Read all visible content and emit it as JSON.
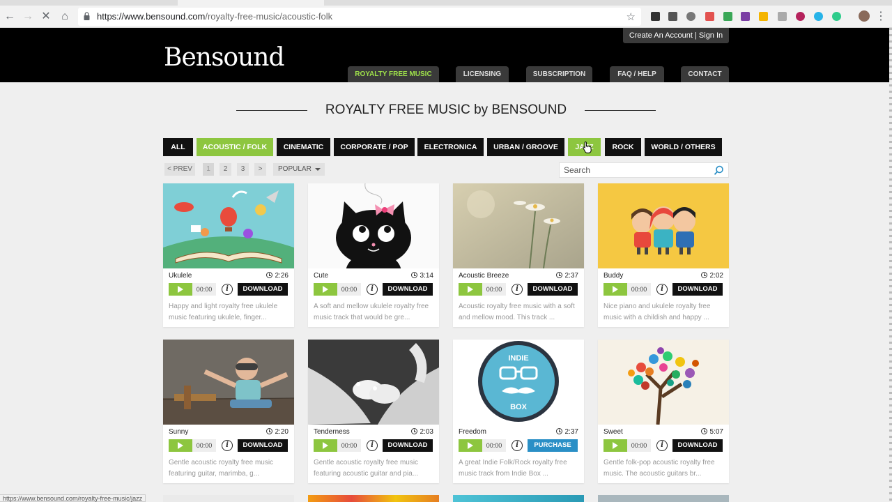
{
  "browser": {
    "url_host": "https://www.bensound.com",
    "url_path": "/royalty-free-music/acoustic-folk",
    "status_url": "https://www.bensound.com/royalty-free-music/jazz"
  },
  "header": {
    "logo": "Bensound",
    "account_link": "Create An Account | Sign In",
    "nav": [
      "ROYALTY FREE MUSIC",
      "LICENSING",
      "SUBSCRIPTION",
      "FAQ / HELP",
      "CONTACT"
    ],
    "accent": "#8dc63f"
  },
  "page_title": "ROYALTY FREE MUSIC by BENSOUND",
  "genres": [
    "ALL",
    "ACOUSTIC / FOLK",
    "CINEMATIC",
    "CORPORATE / POP",
    "ELECTRONICA",
    "URBAN / GROOVE",
    "JAZZ",
    "ROCK",
    "WORLD / OTHERS"
  ],
  "pager": {
    "prev": "< PREV",
    "pages": [
      "1",
      "2",
      "3"
    ],
    "next": ">",
    "sort": "POPULAR"
  },
  "search": {
    "placeholder": "Search"
  },
  "tracks": [
    {
      "title": "Ukulele",
      "duration": "2:26",
      "time": "00:00",
      "action": "DOWNLOAD",
      "desc": "Happy and light royalty free ukulele music featuring ukulele, finger..."
    },
    {
      "title": "Cute",
      "duration": "3:14",
      "time": "00:00",
      "action": "DOWNLOAD",
      "desc": "A soft and mellow ukulele royalty free music track that would be gre..."
    },
    {
      "title": "Acoustic Breeze",
      "duration": "2:37",
      "time": "00:00",
      "action": "DOWNLOAD",
      "desc": "Acoustic royalty free music with a soft and mellow mood. This track ..."
    },
    {
      "title": "Buddy",
      "duration": "2:02",
      "time": "00:00",
      "action": "DOWNLOAD",
      "desc": "Nice piano and ukulele royalty free music with a childish and happy ..."
    },
    {
      "title": "Sunny",
      "duration": "2:20",
      "time": "00:00",
      "action": "DOWNLOAD",
      "desc": "Gentle acoustic royalty free music featuring guitar, marimba, g..."
    },
    {
      "title": "Tenderness",
      "duration": "2:03",
      "time": "00:00",
      "action": "DOWNLOAD",
      "desc": "Gentle acoustic royalty free music featuring acoustic guitar and pia..."
    },
    {
      "title": "Freedom",
      "duration": "2:37",
      "time": "00:00",
      "action": "PURCHASE",
      "desc": "A great Indie Folk/Rock royalty free music track from Indie Box ..."
    },
    {
      "title": "Sweet",
      "duration": "5:07",
      "time": "00:00",
      "action": "DOWNLOAD",
      "desc": "Gentle folk-pop acoustic royalty free music. The acoustic guitars br..."
    }
  ],
  "freedom_badge": {
    "line1": "INDIE",
    "line2": "BOX"
  }
}
